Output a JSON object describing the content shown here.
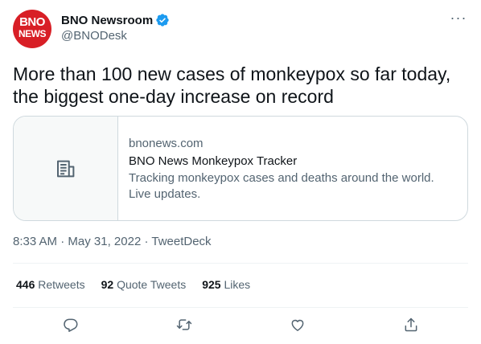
{
  "author": {
    "avatar_line1": "BNO",
    "avatar_line2": "NEWS",
    "display_name": "BNO Newsroom",
    "handle": "@BNODesk",
    "verified": true
  },
  "tweet": {
    "text": "More than 100 new cases of monkeypox so far today, the biggest one-day increase on record"
  },
  "card": {
    "domain": "bnonews.com",
    "title": "BNO News Monkeypox Tracker",
    "description": "Tracking monkeypox cases and deaths around the world. Live updates.",
    "thumb_icon": "article-icon"
  },
  "meta": {
    "time": "8:33 AM",
    "date": "May 31, 2022",
    "source": "TweetDeck",
    "separator": " · "
  },
  "stats": {
    "retweets_count": "446",
    "retweets_label": "Retweets",
    "quotes_count": "92",
    "quotes_label": "Quote Tweets",
    "likes_count": "925",
    "likes_label": "Likes"
  },
  "actions": [
    "reply-icon",
    "retweet-icon",
    "like-icon",
    "share-icon"
  ],
  "colors": {
    "text": "#0f1419",
    "secondary": "#536471",
    "border": "#cfd9de",
    "verified": "#1d9bf0",
    "brand": "#d81f26"
  }
}
